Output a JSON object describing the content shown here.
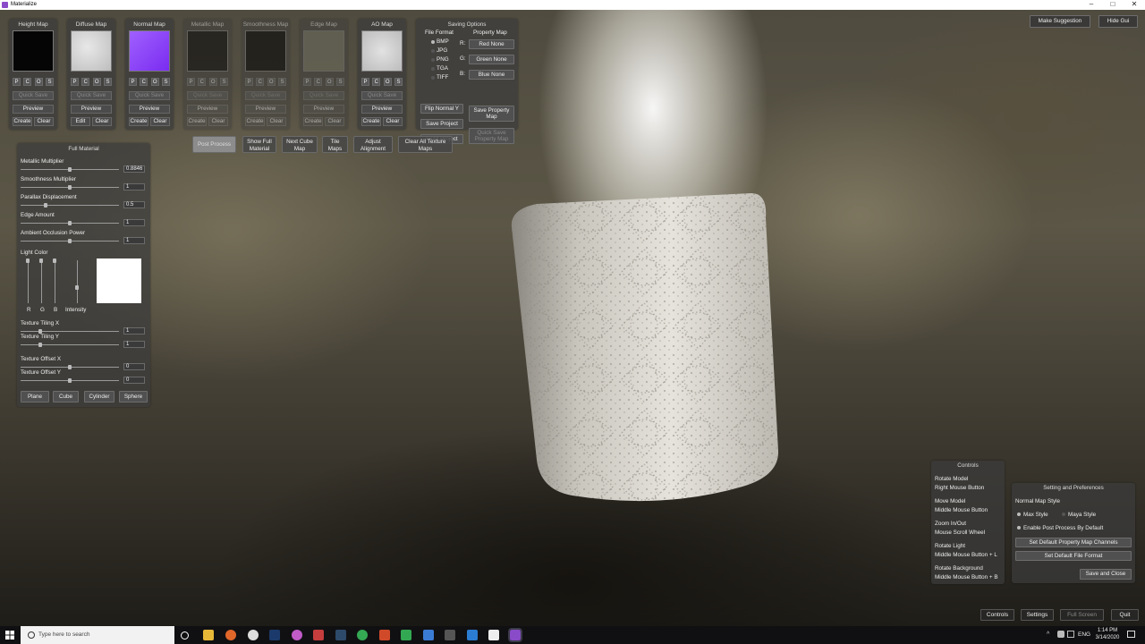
{
  "window": {
    "title": "Materialize",
    "minimize": "–",
    "maximize": "□",
    "close": "✕"
  },
  "maps": [
    {
      "title": "Height Map",
      "pcos": [
        "P",
        "C",
        "O",
        "S"
      ],
      "quick_save": "Quick Save",
      "preview": "Preview",
      "left": "Create",
      "right": "Clear"
    },
    {
      "title": "Diffuse Map",
      "pcos": [
        "P",
        "C",
        "O",
        "S"
      ],
      "quick_save": "Quick Save",
      "preview": "Preview",
      "left": "Edit",
      "right": "Clear"
    },
    {
      "title": "Normal Map",
      "pcos": [
        "P",
        "C",
        "O",
        "S"
      ],
      "quick_save": "Quick Save",
      "preview": "Preview",
      "left": "Create",
      "right": "Clear"
    },
    {
      "title": "Metallic Map",
      "pcos": [
        "P",
        "C",
        "O",
        "S"
      ],
      "quick_save": "Quick Save",
      "preview": "Preview",
      "left": "Create",
      "right": "Clear"
    },
    {
      "title": "Smoothness Map",
      "pcos": [
        "P",
        "C",
        "O",
        "S"
      ],
      "quick_save": "Quick Save",
      "preview": "Preview",
      "left": "Create",
      "right": "Clear"
    },
    {
      "title": "Edge Map",
      "pcos": [
        "P",
        "C",
        "O",
        "S"
      ],
      "quick_save": "Quick Save",
      "preview": "Preview",
      "left": "Create",
      "right": "Clear"
    },
    {
      "title": "AO Map",
      "pcos": [
        "P",
        "C",
        "O",
        "S"
      ],
      "quick_save": "Quick Save",
      "preview": "Preview",
      "left": "Create",
      "right": "Clear"
    }
  ],
  "saving": {
    "title": "Saving Options",
    "file_format_label": "File Format",
    "formats": [
      "BMP",
      "JPG",
      "PNG",
      "TGA",
      "TIFF"
    ],
    "selected_format": "BMP",
    "property_map_label": "Property Map",
    "channels": [
      {
        "key": "R:",
        "value": "Red None"
      },
      {
        "key": "G:",
        "value": "Green None"
      },
      {
        "key": "B:",
        "value": "Blue None"
      }
    ],
    "flip_normal": "Flip Normal Y",
    "save_project": "Save Project",
    "load_project": "Load Project",
    "save_property_map": "Save Property Map",
    "quick_save_property_map": "Quick Save Property Map"
  },
  "toolbar": [
    {
      "label": "Post Process"
    },
    {
      "label": "Show Full Material"
    },
    {
      "label": "Next Cube Map"
    },
    {
      "label": "Tile Maps"
    },
    {
      "label": "Adjust Alignment"
    },
    {
      "label": "Clear All Texture Maps"
    }
  ],
  "material": {
    "title": "Full Material",
    "sliders": [
      {
        "label": "Metallic Multiplier",
        "value": "0.8846",
        "level": 0.5
      },
      {
        "label": "Smoothness Multiplier",
        "value": "1",
        "level": 0.5
      },
      {
        "label": "Parallax Displacement",
        "value": "0.5",
        "level": 0.25
      },
      {
        "label": "Edge Amount",
        "value": "1",
        "level": 0.5
      },
      {
        "label": "Ambient Occlusion Power",
        "value": "1",
        "level": 0.5
      }
    ],
    "light_color_label": "Light Color",
    "light_channels": [
      "R",
      "G",
      "B"
    ],
    "intensity_label": "Intensity",
    "light_color_hex": "#ffffff",
    "tiling": [
      {
        "label": "Texture Tiling X",
        "value": "1",
        "level": 0.2
      },
      {
        "label": "Texture Tiling Y",
        "value": "1",
        "level": 0.2
      }
    ],
    "offset": [
      {
        "label": "Texture Offset X",
        "value": "0",
        "level": 0.5
      },
      {
        "label": "Texture Offset Y",
        "value": "0",
        "level": 0.5
      }
    ],
    "shapes": [
      "Plane",
      "Cube",
      "Cylinder",
      "Sphere"
    ]
  },
  "top_right": {
    "suggest": "Make Suggestion",
    "hide": "Hide Gui"
  },
  "controls": {
    "title": "Controls",
    "items": [
      {
        "action": "Rotate Model",
        "input": "Right Mouse Button"
      },
      {
        "action": "Move Model",
        "input": "Middle Mouse Button"
      },
      {
        "action": "Zoom In/Out",
        "input": "Mouse Scroll Wheel"
      },
      {
        "action": "Rotate Light",
        "input": "Middle Mouse Button + L"
      },
      {
        "action": "Rotate Background",
        "input": "Middle Mouse Button + B"
      }
    ]
  },
  "prefs": {
    "title": "Setting and Preferences",
    "normal_style_label": "Normal Map Style",
    "max_style": "Max Style",
    "maya_style": "Maya Style",
    "post_process": "Enable Post Process By Default",
    "default_channels": "Set Default Property Map Channels",
    "default_format": "Set Default File Format",
    "save_close": "Save and Close"
  },
  "bottom": {
    "controls": "Controls",
    "settings": "Settings",
    "fullscreen": "Full Screen",
    "quit": "Quit"
  },
  "taskbar": {
    "search_placeholder": "Type here to search",
    "language": "ENG",
    "time": "1:14 PM",
    "date": "3/14/2020"
  }
}
